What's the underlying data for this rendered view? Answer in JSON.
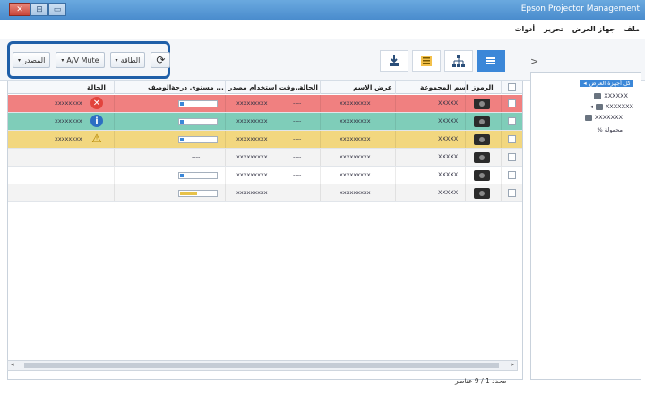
{
  "window": {
    "title": "Epson Projector Management",
    "buttons": [
      "✕",
      "⊟",
      "▭"
    ]
  },
  "menu": {
    "items": [
      "ملف",
      "جهاز العرض",
      "تحرير",
      "أدوات"
    ]
  },
  "toolbar": {
    "refresh_icon": "refresh-icon",
    "power_label": "الطاقة",
    "av_mute_label": "A/V Mute",
    "source_label": "المصدر",
    "collapse_label": ">"
  },
  "grid": {
    "headers": [
      "الرموز",
      "اسم المجموعة",
      "عرض الاسم",
      "الحالة",
      "وقت استخدام مصدر...",
      "مستوى درجة ...",
      "الوصف",
      "الحالة"
    ],
    "rows": [
      {
        "bg": "#f08080",
        "status_text": "xxxxxxxx",
        "status_icon": "error-icon",
        "status_color": "#e2443d",
        "symbol": "xxxxxx",
        "time": "xxxxxxxxx",
        "state": "----",
        "name": "xxxxxxxxx",
        "group": "XXXXX",
        "meter_fill": 0.1,
        "meter_color": "#3b87d8"
      },
      {
        "bg": "#7fcdb9",
        "status_text": "xxxxxxxx",
        "status_icon": "info-icon",
        "status_color": "#2d6fc3",
        "symbol": "xxxxxx",
        "time": "xxxxxxxxx",
        "state": "----",
        "name": "xxxxxxxxx",
        "group": "XXXXX",
        "meter_fill": 0.1,
        "meter_color": "#3b87d8"
      },
      {
        "bg": "#f2d77f",
        "status_text": "xxxxxxxx",
        "status_icon": "warning-icon",
        "status_color": "#e0b000",
        "symbol": "xxxxxx",
        "time": "xxxxxxxxx",
        "state": "----",
        "name": "xxxxxxxxx",
        "group": "XXXXX",
        "meter_fill": 0.1,
        "meter_color": "#3b87d8"
      },
      {
        "bg": "#f3f3f3",
        "status_text": "",
        "status_icon": "",
        "status_color": "",
        "symbol": "xxxxxx",
        "time": "xxxxxxxxx",
        "state": "----",
        "name": "xxxxxxxxx",
        "group": "XXXXX",
        "meter_fill": 0,
        "meter_color": ""
      },
      {
        "bg": "#ffffff",
        "status_text": "",
        "status_icon": "",
        "status_color": "",
        "symbol": "xxxxxx",
        "time": "xxxxxxxxx",
        "state": "----",
        "name": "xxxxxxxxx",
        "group": "XXXXX",
        "meter_fill": 0.1,
        "meter_color": "#3b87d8"
      },
      {
        "bg": "#f3f3f3",
        "status_text": "",
        "status_icon": "",
        "status_color": "",
        "symbol": "xxxxxx",
        "time": "xxxxxxxxx",
        "state": "----",
        "name": "xxxxxxxxx",
        "group": "XXXXX",
        "meter_fill": 0.45,
        "meter_color": "#e7c24a"
      }
    ]
  },
  "footer": {
    "text": "محدد 1 / 9 عناصر"
  },
  "tree": {
    "items": [
      {
        "label": "كل أجهزة العرض",
        "selected": true
      },
      {
        "label": "XXXXXX",
        "selected": false
      },
      {
        "label": "XXXXXXX",
        "selected": false
      },
      {
        "label": "XXXXXXX",
        "selected": false
      },
      {
        "label": "% محمولة",
        "selected": false
      }
    ]
  }
}
